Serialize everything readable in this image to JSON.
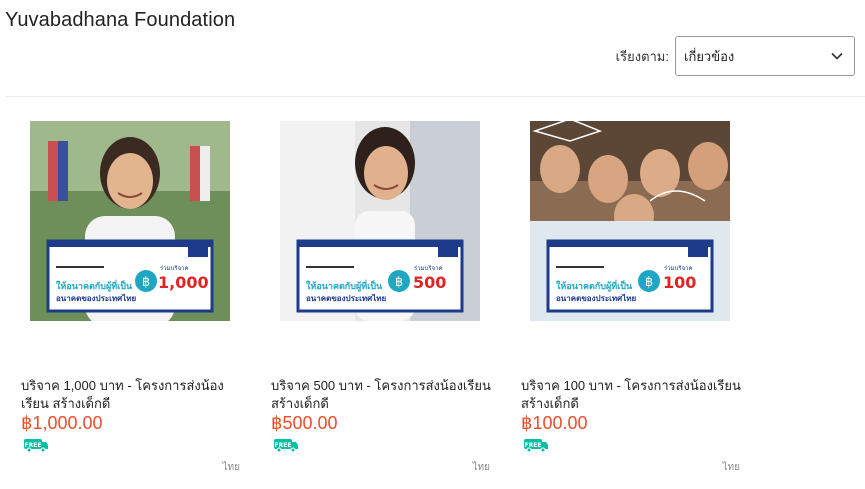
{
  "shop": {
    "title": "Yuvabadhana Foundation"
  },
  "sort": {
    "label": "เรียงตาม:",
    "selected": "เกี่ยวข้อง"
  },
  "products": [
    {
      "title": "บริจาค 1,000 บาท - โครงการส่งน้องเรียน สร้างเด็กดี",
      "price": "฿1,000.00",
      "badge": "FREE",
      "lang": "ไทย",
      "banner_amount": "1,000",
      "banner_amount_label": "ร่วมบริจาค",
      "banner_slogan_1": "ให้อนาคตกับผู้ที่เป็น",
      "banner_slogan_2": "อนาคตของประเทศไทย"
    },
    {
      "title": "บริจาค 500 บาท - โครงการส่งน้องเรียน สร้างเด็กดี",
      "price": "฿500.00",
      "badge": "FREE",
      "lang": "ไทย",
      "banner_amount": "500",
      "banner_amount_label": "ร่วมบริจาค",
      "banner_slogan_1": "ให้อนาคตกับผู้ที่เป็น",
      "banner_slogan_2": "อนาคตของประเทศไทย"
    },
    {
      "title": "บริจาค 100 บาท - โครงการส่งน้องเรียน สร้างเด็กดี",
      "price": "฿100.00",
      "badge": "FREE",
      "lang": "ไทย",
      "banner_amount": "100",
      "banner_amount_label": "ร่วมบริจาค",
      "banner_slogan_1": "ให้อนาคตกับผู้ที่เป็น",
      "banner_slogan_2": "อนาคตของประเทศไทย"
    }
  ],
  "colors": {
    "price": "#ee4d2d",
    "free_badge": "#00bfa5",
    "banner_navy": "#1d3b8a",
    "banner_cyan": "#1ea7c4",
    "banner_red": "#e02424"
  },
  "icons": {
    "sort_chevron": "chevron-down-icon",
    "free_shipping": "free-shipping-truck-icon",
    "baht": "baht-icon"
  }
}
